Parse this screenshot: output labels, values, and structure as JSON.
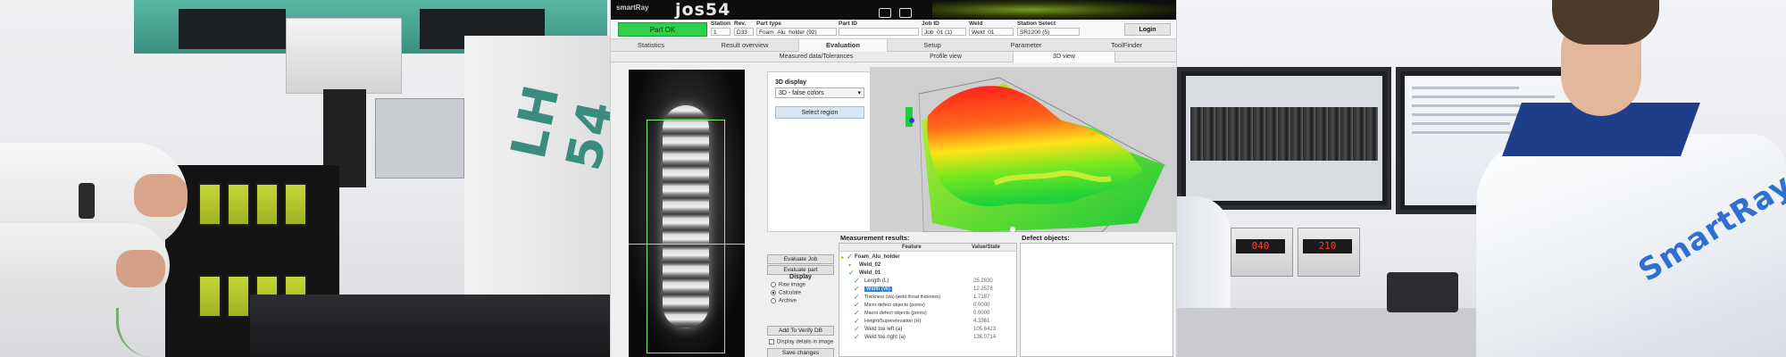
{
  "photo_left": {
    "machine_label": "LH 54"
  },
  "app": {
    "brand_small": "smartRay",
    "brand_logo": "jos54",
    "part_status": "Part OK",
    "status_color": "#2fd04a",
    "fields": [
      {
        "label": "Station",
        "value": "1"
      },
      {
        "label": "Rev.",
        "value": "D33"
      },
      {
        "label": "Part type",
        "value": "Foam_Alu_holder (92)"
      },
      {
        "label": "Part ID",
        "value": ""
      },
      {
        "label": "Job ID",
        "value": "Job_01 (1)"
      },
      {
        "label": "Weld",
        "value": "Weld_01"
      },
      {
        "label": "Station Select",
        "value": "SR1200 (5)"
      }
    ],
    "login_label": "Login",
    "tabs": [
      {
        "label": "Statistics"
      },
      {
        "label": "Result overview"
      },
      {
        "label": "Evaluation"
      },
      {
        "label": "Setup"
      },
      {
        "label": "Parameter"
      },
      {
        "label": "ToolFinder"
      }
    ],
    "subtabs": [
      {
        "label": "Measured data/Tolerances"
      },
      {
        "label": "Profile view"
      },
      {
        "label": "3D view"
      }
    ],
    "display_label": "3D display",
    "display_select": "3D - false colors",
    "select_region_label": "Select region",
    "buttons": {
      "evaluate_job": "Evaluate Job",
      "evaluate_part": "Evaluate part",
      "display_header": "Display",
      "add_to_verify": "Add To Verify DB",
      "display_details": "Display details in image",
      "save_changes": "Save changes"
    },
    "radios": [
      {
        "label": "Raw image",
        "checked": false
      },
      {
        "label": "Calculate",
        "checked": true
      },
      {
        "label": "Archive",
        "checked": false
      }
    ],
    "results_title": "Measurement results:",
    "results_col_feature": "Feature",
    "results_col_value": "Value/State",
    "results_rows": [
      {
        "name": "Foam_Alu_holder",
        "value": "",
        "level": 0,
        "type": "folder-ok"
      },
      {
        "name": "Weld_02",
        "value": "",
        "level": 1,
        "type": "folder"
      },
      {
        "name": "Weld_01",
        "value": "",
        "level": 1,
        "type": "folder-ok"
      },
      {
        "name": "Length (L)",
        "value": "25.2830",
        "level": 2,
        "type": "ok"
      },
      {
        "name": "Width (W)",
        "value": "12.2578",
        "level": 2,
        "type": "ok-selected"
      },
      {
        "name": "Thickness (via) (weld throat thickness)",
        "value": "1.7187",
        "level": 2,
        "type": "ok"
      },
      {
        "name": "Micro defect objects (pores)",
        "value": "0.0000",
        "level": 2,
        "type": "ok"
      },
      {
        "name": "Macro defect objects (pores)",
        "value": "0.0000",
        "level": 2,
        "type": "ok"
      },
      {
        "name": "Height/Superelevation (H)",
        "value": "4.3361",
        "level": 2,
        "type": "ok"
      },
      {
        "name": "Weld toe left (a)",
        "value": "105.6423",
        "level": 2,
        "type": "ok"
      },
      {
        "name": "Weld toe right (a)",
        "value": "136.0714",
        "level": 2,
        "type": "ok"
      }
    ],
    "defects_title": "Defect objects:"
  },
  "photo_right": {
    "coat_logo": "SmartRay",
    "display_values": [
      "040",
      "210"
    ]
  }
}
